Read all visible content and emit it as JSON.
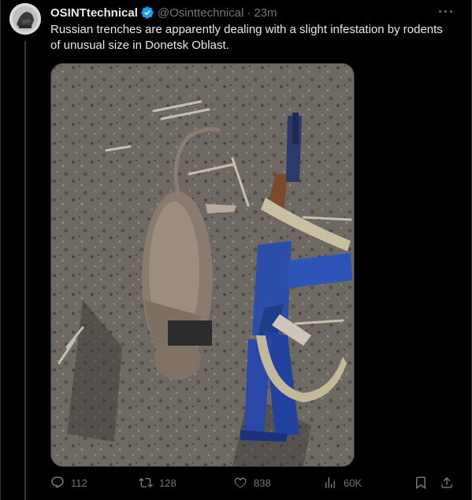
{
  "tweet": {
    "display_name": "OSINTtechnical",
    "handle": "@Osinttechnical",
    "separator": "·",
    "time": "23m",
    "text": "Russian trenches are apparently dealing with a slight infestation by rodents of unusual size in Donetsk Oblast.",
    "more_label": "···"
  },
  "actions": {
    "replies": "112",
    "reposts": "128",
    "likes": "838",
    "views": "60K"
  },
  "icons": {
    "verified": "verified-badge-icon",
    "reply": "reply-icon",
    "repost": "repost-icon",
    "like": "heart-icon",
    "views": "views-chart-icon",
    "bookmark": "bookmark-icon",
    "share": "share-icon"
  },
  "colors": {
    "background": "#000000",
    "text": "#e7e9ea",
    "muted": "#71767b",
    "verified": "#1d9bf0",
    "border": "#2f3336"
  }
}
